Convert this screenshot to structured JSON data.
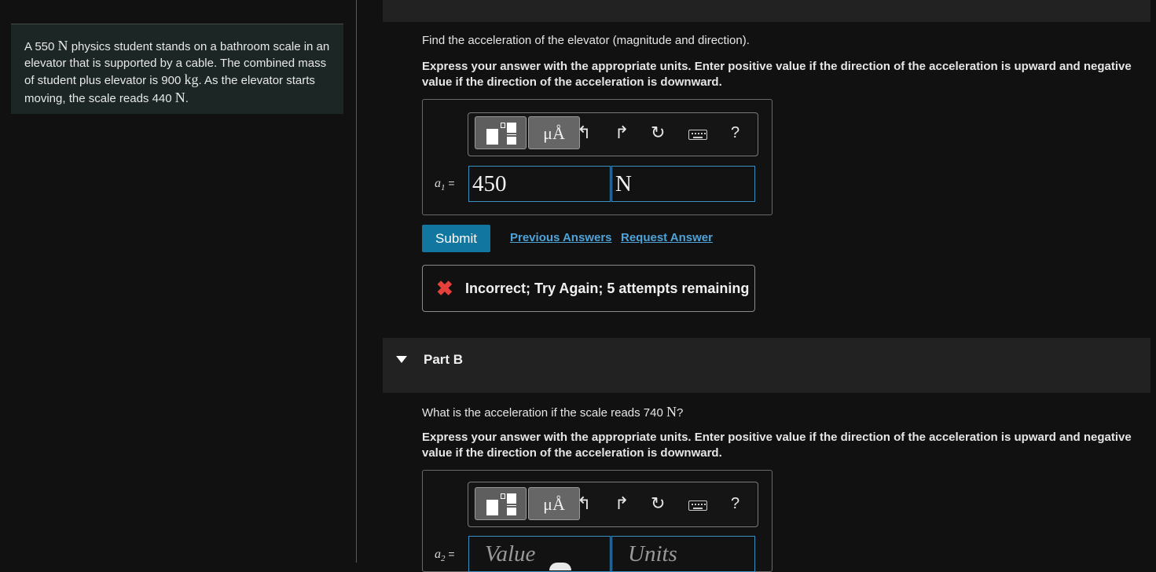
{
  "problem": {
    "text_1": "A 550 ",
    "unit_1": "N",
    "text_2": " physics student stands on a bathroom scale in an elevator that is supported by a cable. The combined mass of student plus elevator is 900 ",
    "unit_2": "kg",
    "text_3": ". As the elevator starts moving, the scale reads 440 ",
    "unit_3": "N",
    "text_4": "."
  },
  "part_a": {
    "question": "Find the acceleration of the elevator (magnitude and direction).",
    "instructions": "Express your answer with the appropriate units. Enter positive value if the direction of the acceleration is upward and negative value if the direction of the acceleration is downward.",
    "label_var": "a",
    "label_sub": "1",
    "label_eq": " =",
    "value": "450",
    "units": "N",
    "submit_label": "Submit",
    "previous_answers_label": "Previous Answers",
    "request_answer_label": "Request Answer",
    "feedback_message": "Incorrect; Try Again; 5 attempts remaining"
  },
  "part_b": {
    "title": "Part B",
    "question_1": "What is the acceleration if the scale reads 740 ",
    "question_unit": "N",
    "question_2": "?",
    "instructions": "Express your answer with the appropriate units. Enter positive value if the direction of the acceleration is upward and negative value if the direction of the acceleration is downward.",
    "label_var": "a",
    "label_sub": "2",
    "label_eq": " =",
    "value_placeholder": "Value",
    "units_placeholder": "Units"
  },
  "toolbar": {
    "mu_label": "μÅ",
    "help_label": "?",
    "icons": [
      "templates-icon",
      "units-icon",
      "undo-icon",
      "redo-icon",
      "reset-icon",
      "keyboard-icon",
      "help-icon"
    ]
  },
  "colors": {
    "background": "#111111",
    "problem_box": "#1b2625",
    "submit": "#1177a0",
    "link": "#4ea3d8",
    "error": "#e5413a",
    "field_border": "#3a8ec0"
  }
}
